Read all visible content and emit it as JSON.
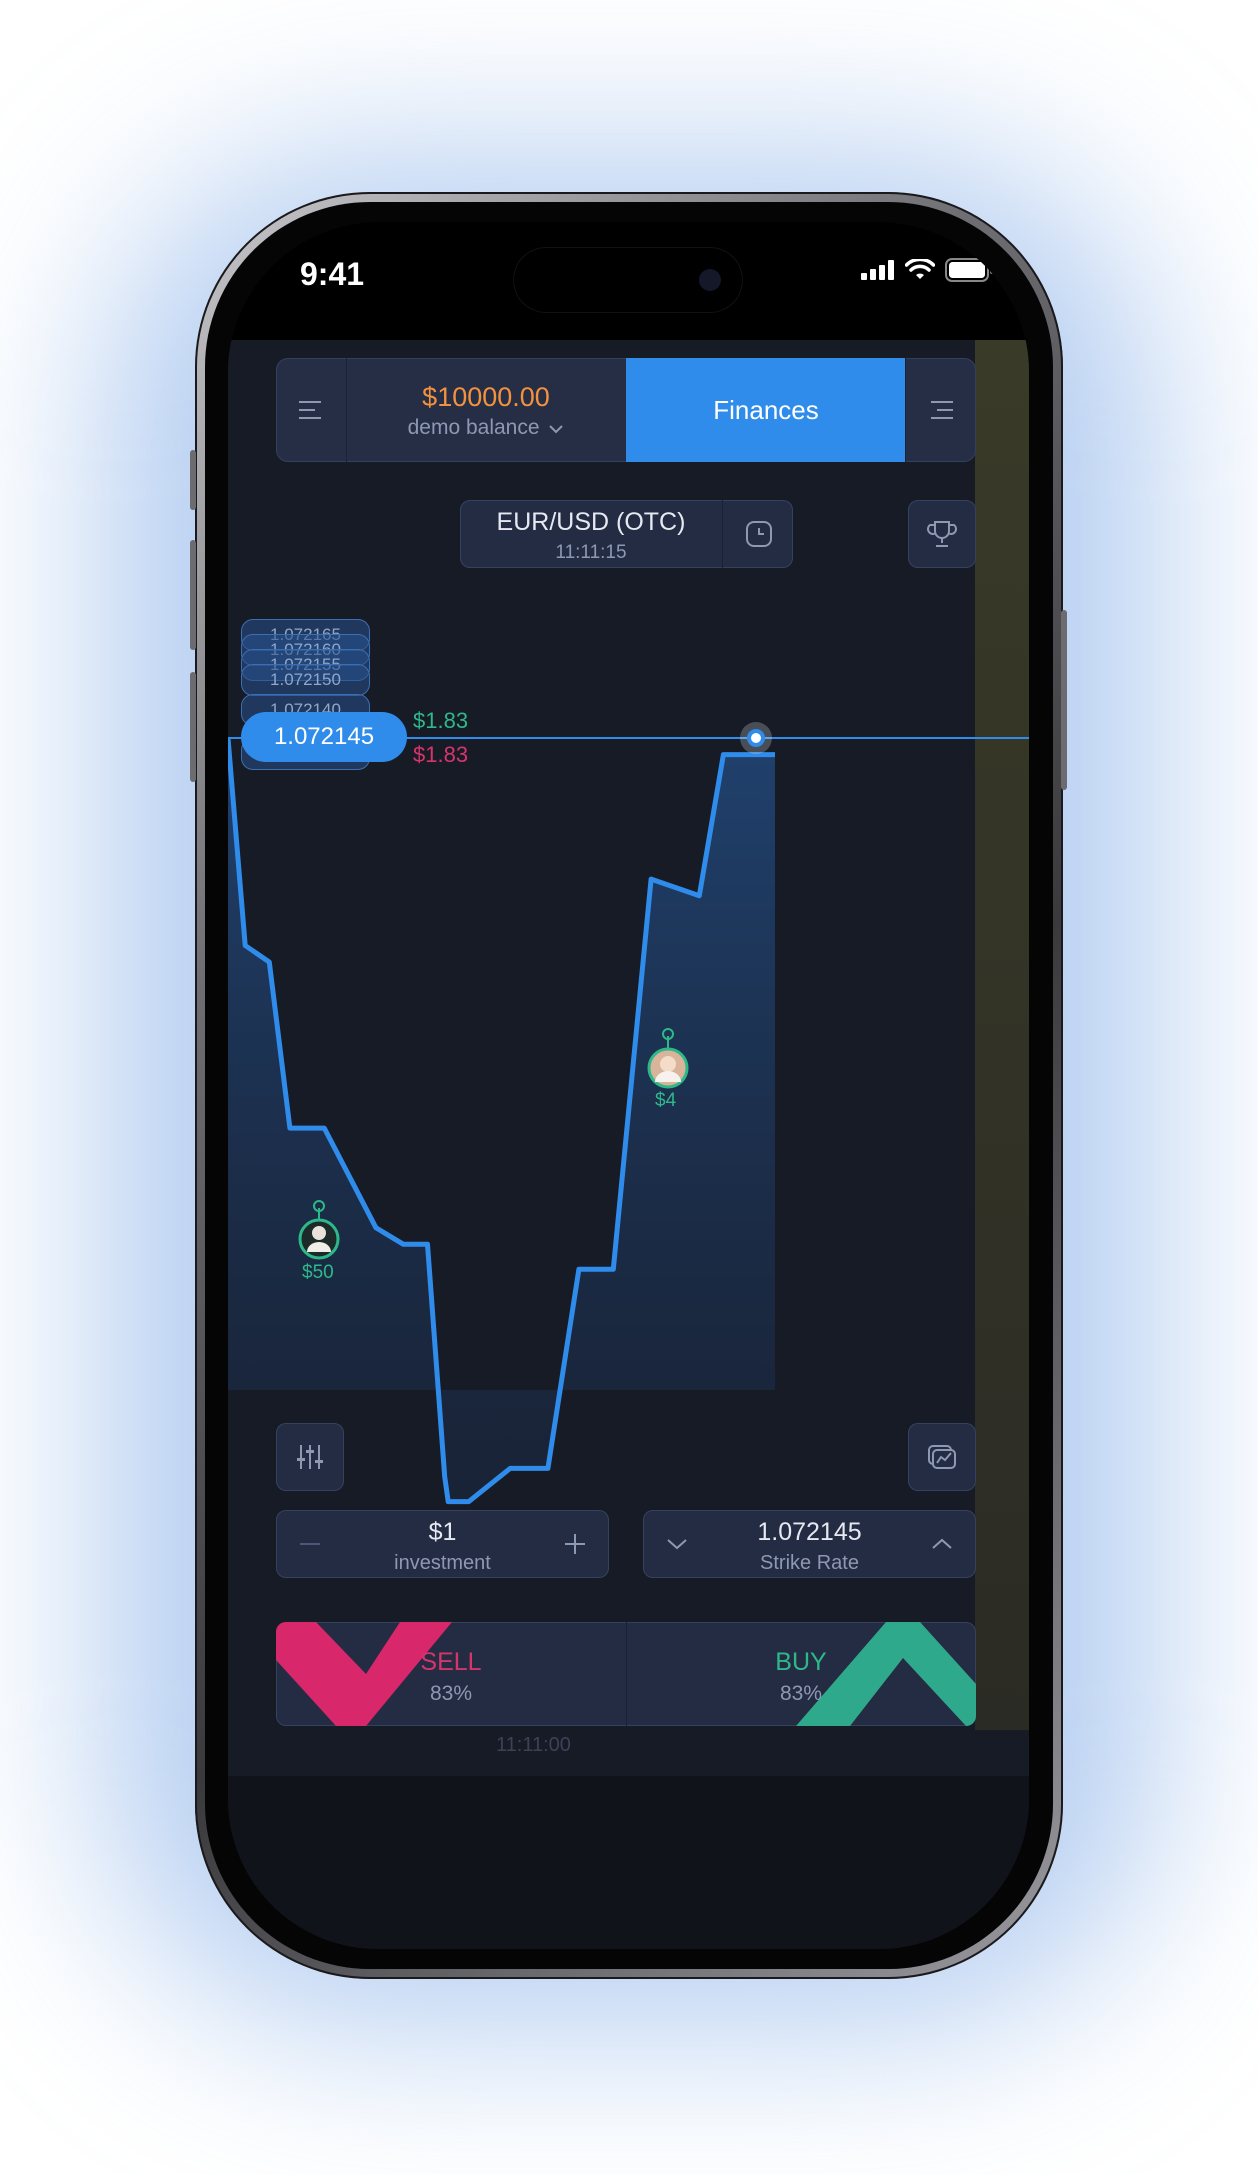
{
  "status_bar": {
    "time": "9:41"
  },
  "header": {
    "balance_amount": "$10000.00",
    "balance_label": "demo balance",
    "finances_label": "Finances",
    "left_menu_icon": "menu-icon",
    "right_menu_icon": "menu-icon"
  },
  "asset": {
    "pair": "EUR/USD (OTC)",
    "time": "11:11:15"
  },
  "price_scale": {
    "stacked": [
      "1.072165",
      "1.072160",
      "1.072155",
      "1.072150",
      "1.072140"
    ],
    "current": "1.072145"
  },
  "payouts": {
    "up": "$1.83",
    "down": "$1.83"
  },
  "traders": [
    {
      "amount": "$50"
    },
    {
      "amount": "$4"
    }
  ],
  "investment": {
    "value": "$1",
    "label": "investment"
  },
  "strike": {
    "value": "1.072145",
    "label": "Strike Rate"
  },
  "trade": {
    "sell_label": "SELL",
    "sell_pct": "83%",
    "buy_label": "BUY",
    "buy_pct": "83%"
  },
  "timeline": {
    "time": "11:11:00"
  },
  "colors": {
    "accent": "#2f8ceb",
    "balance": "#f2913e",
    "up": "#2eb88a",
    "down": "#d8346c",
    "background": "#171b26"
  },
  "chart_data": {
    "type": "line",
    "y_unit": "EUR/USD price",
    "current_price": 1.072145,
    "series": [
      {
        "values": [
          1.072145,
          1.07212,
          1.072118,
          1.072098,
          1.072098,
          1.072086,
          1.072084,
          1.072084,
          1.072056,
          1.072053,
          1.072053,
          1.072057,
          1.072057,
          1.072081,
          1.072081,
          1.072128,
          1.072126,
          1.072143,
          1.072143
        ]
      }
    ]
  }
}
